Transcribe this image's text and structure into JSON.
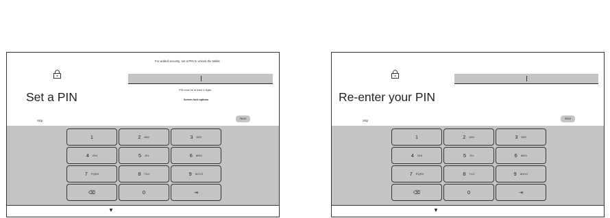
{
  "screens": [
    {
      "id": "set-pin",
      "title": "Set a PIN",
      "hint_top": "For added security, set a PIN to unlock the tablet",
      "pin_note": "PIN must be at least 4 digits",
      "lock_options": "Screen lock options",
      "skip_label": "Skip",
      "next_label": "Next",
      "lock_icon": "lock-icon"
    },
    {
      "id": "reenter-pin",
      "title": "Re-enter your PIN",
      "skip_label": "Skip",
      "next_label": "Next",
      "lock_icon": "lock-icon"
    }
  ],
  "keypad": {
    "keys": [
      {
        "main": "1",
        "sub": ""
      },
      {
        "main": "2",
        "sub": "ABC"
      },
      {
        "main": "3",
        "sub": "DEF"
      },
      {
        "main": "4",
        "sub": "GHI"
      },
      {
        "main": "5",
        "sub": "JKL"
      },
      {
        "main": "6",
        "sub": "MNO"
      },
      {
        "main": "7",
        "sub": "PQRS"
      },
      {
        "main": "8",
        "sub": "TUV"
      },
      {
        "main": "9",
        "sub": "WXYZ"
      },
      {
        "main": "⌫",
        "sub": "",
        "icon": "backspace-icon"
      },
      {
        "main": "0",
        "sub": ""
      },
      {
        "main": "⇥",
        "sub": "",
        "icon": "tab-icon"
      }
    ]
  },
  "nav": {
    "back_glyph": "▼",
    "back_icon": "back-arrow-icon"
  },
  "colors": {
    "keypad_bg": "#c4c4c4",
    "field_bg": "#c4c4c4",
    "border": "#333333"
  }
}
